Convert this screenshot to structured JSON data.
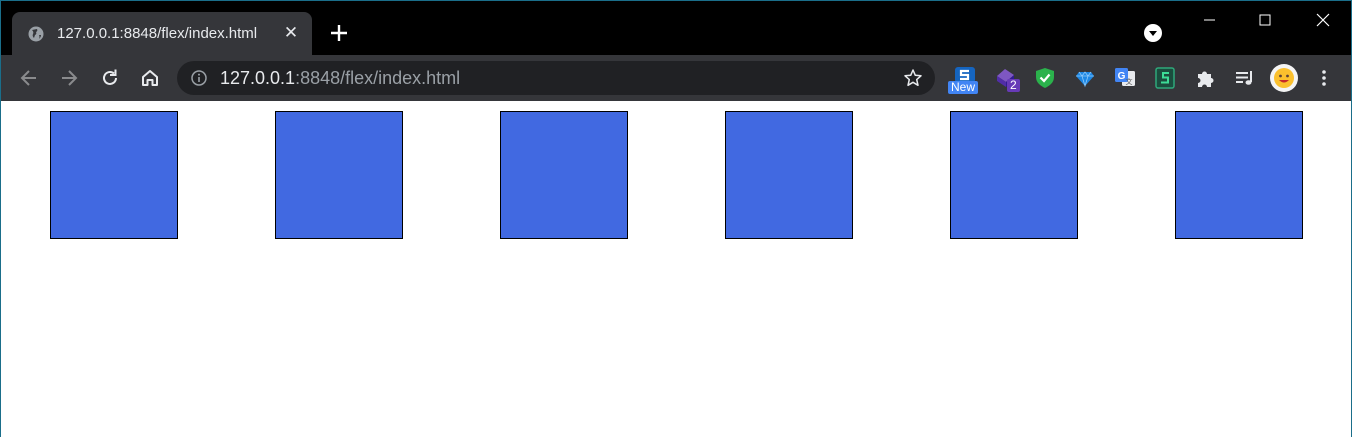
{
  "tab": {
    "title": "127.0.0.1:8848/flex/index.html",
    "close_glyph": "✕"
  },
  "omnibox": {
    "url_host": "127.0.0.1",
    "url_rest": ":8848/flex/index.html"
  },
  "extensions": [
    {
      "icon": "s-new-extension-icon",
      "badge": "New",
      "badge_color": "#4285f4"
    },
    {
      "icon": "purple-cube-extension-icon",
      "badge": "2",
      "badge_color": "#673ab7"
    },
    {
      "icon": "shield-check-extension-icon"
    },
    {
      "icon": "diamond-extension-icon"
    },
    {
      "icon": "google-translate-extension-icon"
    },
    {
      "icon": "s-green-extension-icon"
    },
    {
      "icon": "puzzle-extensions-icon"
    },
    {
      "icon": "media-queue-icon"
    }
  ],
  "page": {
    "box_count": 6,
    "box_color": "#4169e1"
  },
  "colors": {
    "tabstrip": "#000000",
    "toolbar": "#35363a",
    "omnibox": "#202124"
  }
}
